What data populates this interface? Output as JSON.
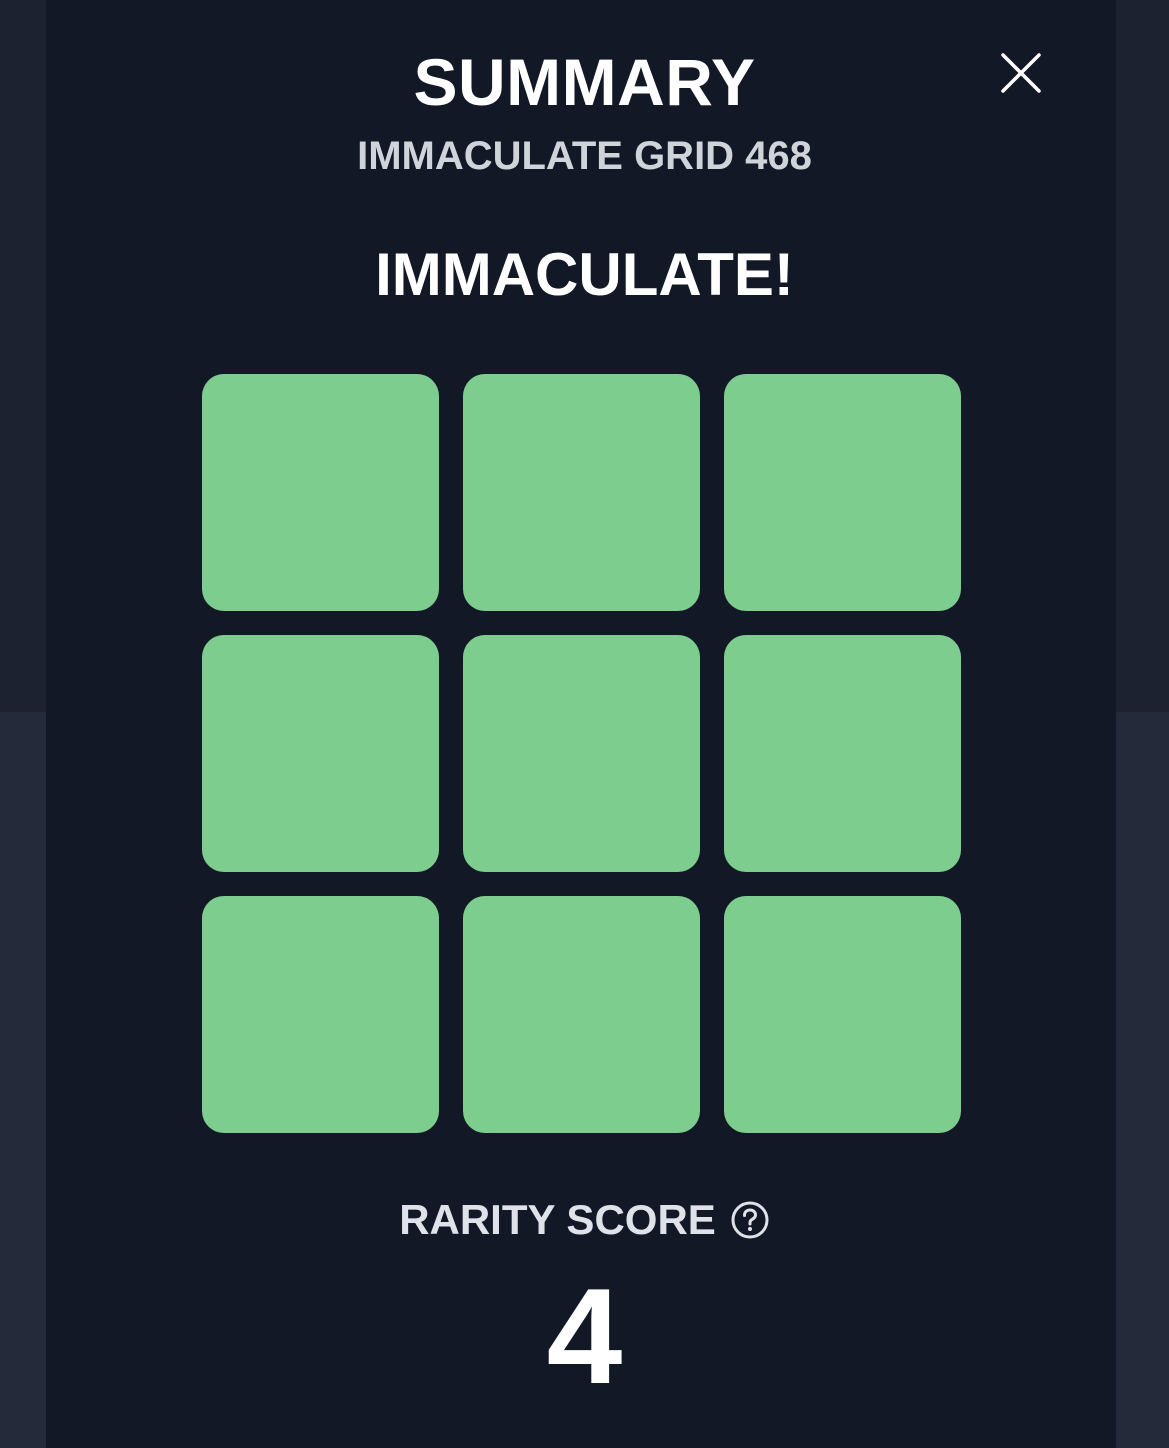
{
  "modal": {
    "title": "SUMMARY",
    "subtitle": "IMMACULATE GRID 468",
    "result": "IMMACULATE!"
  },
  "grid": {
    "rows": 3,
    "cols": 3,
    "cells": [
      "correct",
      "correct",
      "correct",
      "correct",
      "correct",
      "correct",
      "correct",
      "correct",
      "correct"
    ],
    "correct_color": "#7dcd8e"
  },
  "rarity": {
    "label": "RARITY SCORE",
    "value": "4",
    "help_icon": "question-circle-icon"
  },
  "icons": {
    "close": "close-icon"
  },
  "colors": {
    "modal_bg": "#121826",
    "page_bg": "#1c2230",
    "text": "#ffffff",
    "subtext": "#cfd3da"
  }
}
